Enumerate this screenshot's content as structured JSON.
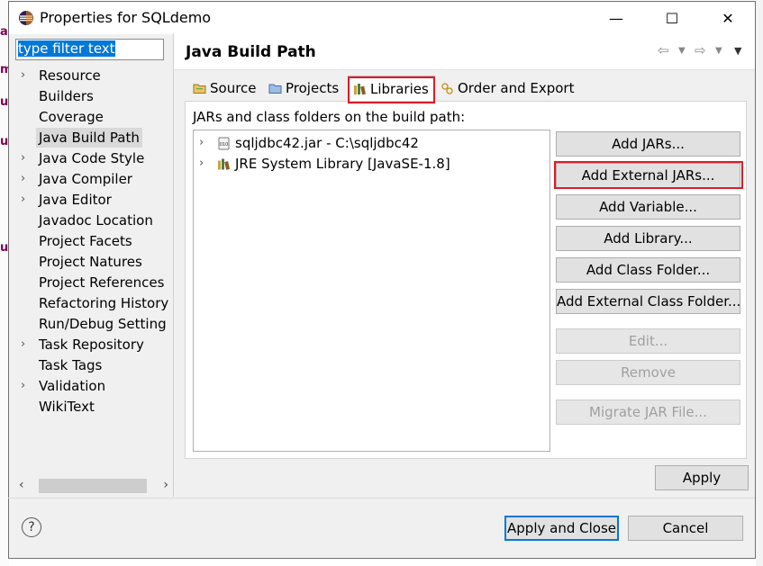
{
  "window": {
    "title": "Properties for SQLdemo",
    "minimize_glyph": "—",
    "maximize_glyph": "☐",
    "close_glyph": "✕"
  },
  "filter": {
    "value": "type filter text"
  },
  "nav": {
    "items": [
      {
        "label": "Resource",
        "expandable": true
      },
      {
        "label": "Builders",
        "expandable": false
      },
      {
        "label": "Coverage",
        "expandable": false
      },
      {
        "label": "Java Build Path",
        "expandable": false,
        "selected": true
      },
      {
        "label": "Java Code Style",
        "expandable": true
      },
      {
        "label": "Java Compiler",
        "expandable": true
      },
      {
        "label": "Java Editor",
        "expandable": true
      },
      {
        "label": "Javadoc Location",
        "expandable": false
      },
      {
        "label": "Project Facets",
        "expandable": false
      },
      {
        "label": "Project Natures",
        "expandable": false
      },
      {
        "label": "Project References",
        "expandable": false
      },
      {
        "label": "Refactoring History",
        "expandable": false
      },
      {
        "label": "Run/Debug Setting",
        "expandable": false
      },
      {
        "label": "Task Repository",
        "expandable": true
      },
      {
        "label": "Task Tags",
        "expandable": false
      },
      {
        "label": "Validation",
        "expandable": true
      },
      {
        "label": "WikiText",
        "expandable": false
      }
    ]
  },
  "page": {
    "title": "Java Build Path"
  },
  "tabs": [
    {
      "label": "Source",
      "icon": "source-folder-icon"
    },
    {
      "label": "Projects",
      "icon": "projects-folder-icon"
    },
    {
      "label": "Libraries",
      "icon": "libraries-icon",
      "active": true
    },
    {
      "label": "Order and Export",
      "icon": "order-export-icon"
    }
  ],
  "libraries": {
    "heading": "JARs and class folders on the build path:",
    "entries": [
      {
        "label": "sqljdbc42.jar - C:\\sqljdbc42",
        "icon": "jar-icon"
      },
      {
        "label": "JRE System Library [JavaSE-1.8]",
        "icon": "library-icon"
      }
    ]
  },
  "buttons": {
    "add_jars": "Add JARs...",
    "add_external_jars": "Add External JARs...",
    "add_variable": "Add Variable...",
    "add_library": "Add Library...",
    "add_class_folder": "Add Class Folder...",
    "add_external_class_folder": "Add External Class Folder...",
    "edit": "Edit...",
    "remove": "Remove",
    "migrate_jar": "Migrate JAR File...",
    "apply": "Apply",
    "apply_and_close": "Apply and Close",
    "cancel": "Cancel",
    "help": "?"
  },
  "colors": {
    "highlight": "#e01b24",
    "selection": "#0078d7"
  }
}
